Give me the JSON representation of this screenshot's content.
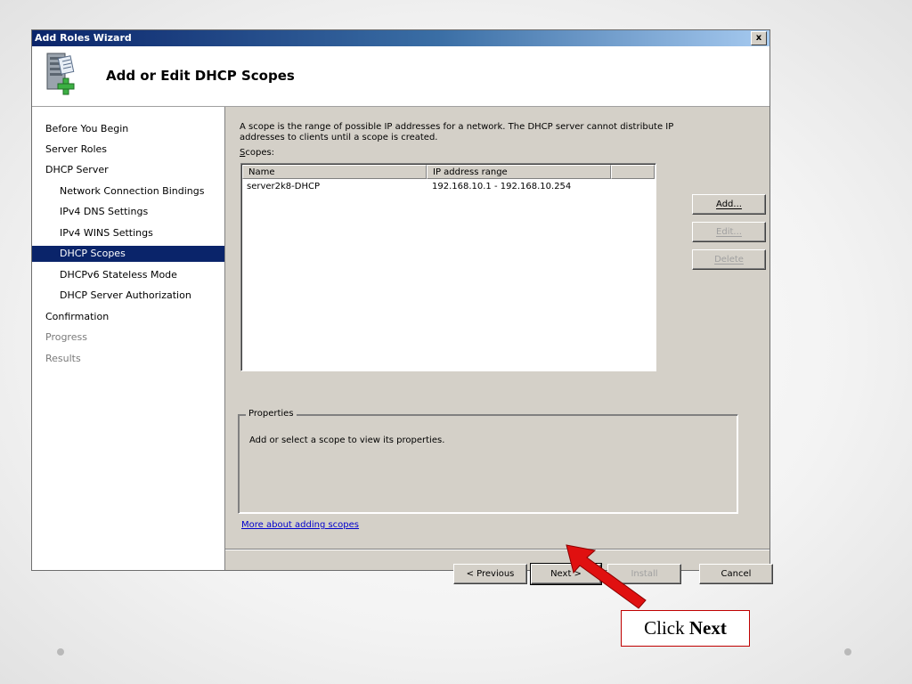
{
  "window": {
    "title": "Add Roles Wizard",
    "close_label": "x"
  },
  "header": {
    "title": "Add or Edit DHCP Scopes",
    "icon": "server-add-role-icon"
  },
  "sidebar": {
    "items": [
      {
        "label": "Before You Begin",
        "level": "top",
        "state": "normal"
      },
      {
        "label": "Server Roles",
        "level": "top",
        "state": "normal"
      },
      {
        "label": "DHCP Server",
        "level": "top",
        "state": "normal"
      },
      {
        "label": "Network Connection Bindings",
        "level": "sub",
        "state": "normal"
      },
      {
        "label": "IPv4 DNS Settings",
        "level": "sub",
        "state": "normal"
      },
      {
        "label": "IPv4 WINS Settings",
        "level": "sub",
        "state": "normal"
      },
      {
        "label": "DHCP Scopes",
        "level": "sub",
        "state": "selected"
      },
      {
        "label": "DHCPv6 Stateless Mode",
        "level": "sub",
        "state": "normal"
      },
      {
        "label": "DHCP Server Authorization",
        "level": "sub",
        "state": "normal"
      },
      {
        "label": "Confirmation",
        "level": "top",
        "state": "normal"
      },
      {
        "label": "Progress",
        "level": "top",
        "state": "disabled"
      },
      {
        "label": "Results",
        "level": "top",
        "state": "disabled"
      }
    ]
  },
  "main": {
    "description": "A scope is the range of possible IP addresses for a network. The DHCP server cannot distribute IP addresses to clients until a scope is created.",
    "scopes_label_accel": "S",
    "scopes_label_rest": "copes:",
    "table": {
      "columns": [
        "Name",
        "IP address range",
        ""
      ],
      "rows": [
        {
          "name": "server2k8-DHCP",
          "range": "192.168.10.1 - 192.168.10.254"
        }
      ]
    },
    "buttons": {
      "add": "Add...",
      "edit": "Edit...",
      "delete": "Delete"
    },
    "properties": {
      "title": "Properties",
      "text": "Add or select a scope to view its properties."
    },
    "link": "More about adding scopes"
  },
  "footer": {
    "previous": "< Previous",
    "next": "Next >",
    "install": "Install",
    "cancel": "Cancel"
  },
  "annotation": {
    "prefix": "Click ",
    "emphasis": "Next",
    "arrow_color": "#e01010"
  }
}
